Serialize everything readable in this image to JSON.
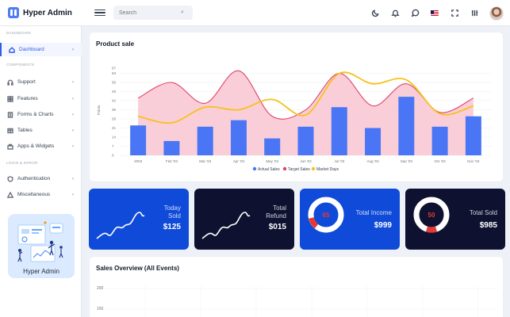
{
  "app": {
    "brand": "Hyper Admin"
  },
  "topbar": {
    "search_placeholder": "Search",
    "icons": [
      "moon-icon",
      "bell-icon",
      "chat-icon",
      "flag-icon",
      "fullscreen-icon",
      "settings-sliders-icon"
    ]
  },
  "sidebar": {
    "section_dashboard": "DASHBOARD",
    "dashboard": "Dashboard",
    "section_components": "COMPONENTS",
    "components": [
      {
        "label": "Support",
        "icon": "headset-icon"
      },
      {
        "label": "Features",
        "icon": "grid-icon"
      },
      {
        "label": "Forms & Charts",
        "icon": "forms-icon"
      },
      {
        "label": "Tables",
        "icon": "table-icon"
      },
      {
        "label": "Apps & Widgets",
        "icon": "apps-icon"
      }
    ],
    "section_login": "LOGIN & ERROR",
    "login": [
      {
        "label": "Authentication",
        "icon": "shield-icon"
      },
      {
        "label": "Miscellaneous",
        "icon": "triangle-icon"
      }
    ],
    "promo_title": "Hyper Admin"
  },
  "product_sale": {
    "title": "Product sale",
    "ylabel": "Points"
  },
  "chart_data": {
    "type": "mixed",
    "title": "Product sale",
    "ylabel": "Points",
    "categories": [
      "2003",
      "Feb '03",
      "Mar '03",
      "Apr '03",
      "May '03",
      "Jun '03",
      "Jul '03",
      "Aug '03",
      "Sep '03",
      "Oct '03",
      "Nov '03"
    ],
    "ylim": [
      0,
      67
    ],
    "yticks": [
      0,
      7,
      14,
      21,
      28,
      35,
      42,
      49,
      56,
      63
    ],
    "ytick_labels": [
      "0",
      "7",
      "14",
      "21",
      "28",
      "35",
      "42",
      "49",
      "56",
      "63",
      "67"
    ],
    "series": [
      {
        "name": "Actual Sales",
        "type": "bar",
        "color": "#4a76f5",
        "values": [
          23,
          11,
          22,
          27,
          13,
          22,
          37,
          21,
          45,
          22,
          30
        ]
      },
      {
        "name": "Target Sales",
        "type": "area",
        "color": "#e0446a",
        "values": [
          44,
          56,
          40,
          65,
          30,
          35,
          63,
          38,
          55,
          33,
          44
        ]
      },
      {
        "name": "Market Days",
        "type": "line",
        "color": "#f6c21b",
        "values": [
          30,
          25,
          37,
          35,
          43,
          31,
          63,
          55,
          58,
          32,
          38
        ]
      }
    ],
    "legend": "bottom",
    "grid": true
  },
  "stats": [
    {
      "label1": "Today",
      "label2": "Sold",
      "value": "$125",
      "color": "#0f4ad8"
    },
    {
      "label1": "Total",
      "label2": "Refund",
      "value": "$015",
      "color": "#0e1230"
    },
    {
      "label1": "Total Income",
      "label2": "",
      "value": "$999",
      "donut_value": "65",
      "color": "#0f4ad8"
    },
    {
      "label1": "Total Sold",
      "label2": "",
      "value": "$985",
      "donut_value": "50",
      "color": "#0e1230"
    }
  ],
  "sales_overview": {
    "title": "Sales Overview (All Events)",
    "yticks": [
      "200",
      "150"
    ]
  }
}
